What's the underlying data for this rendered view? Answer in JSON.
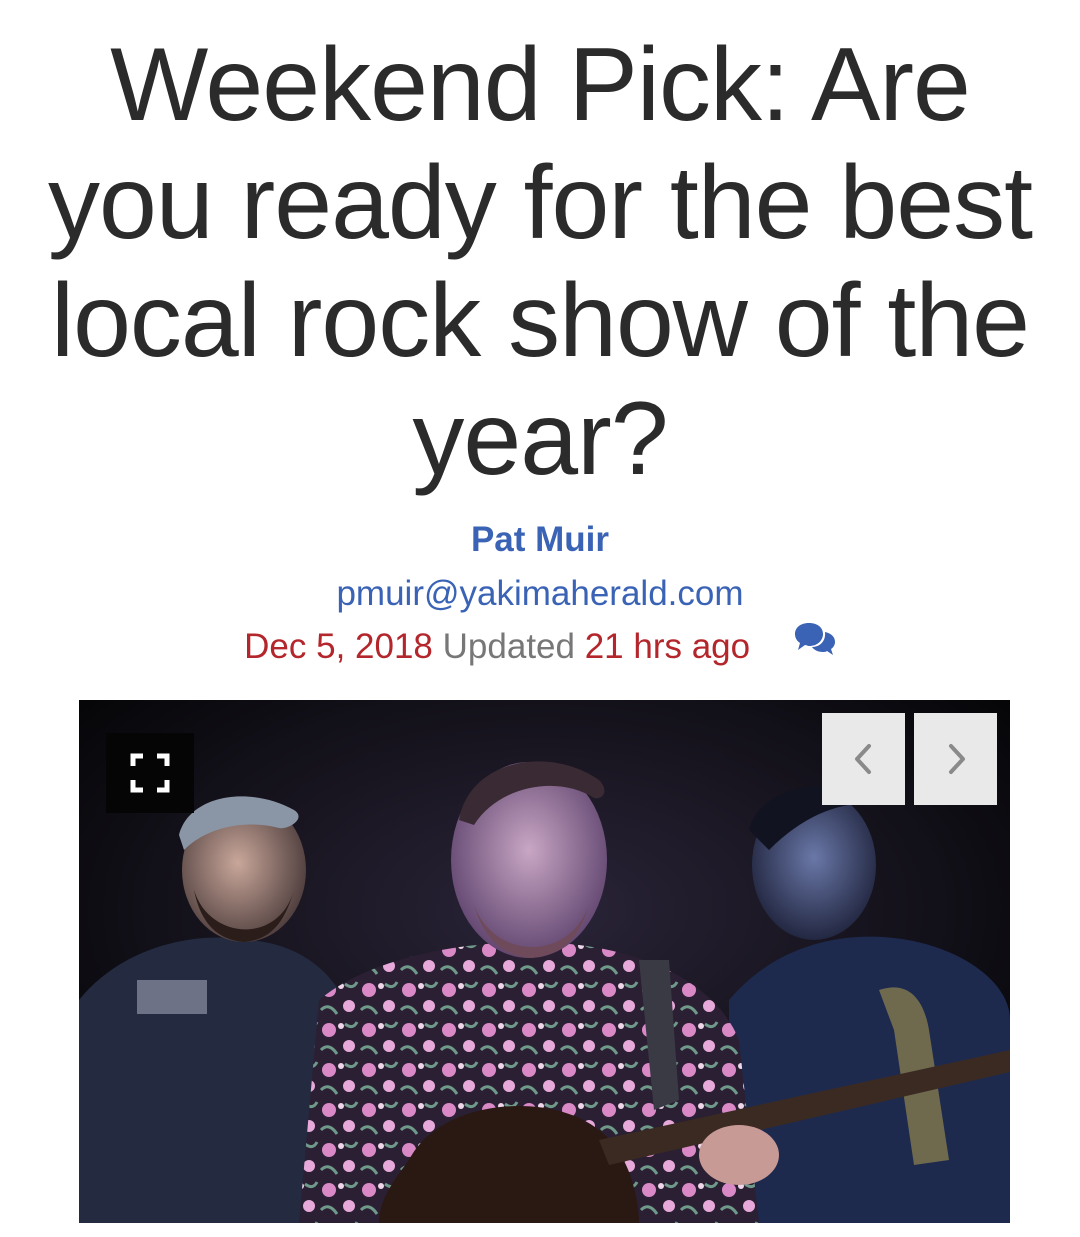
{
  "article": {
    "headline": "Weekend Pick: Are you ready for the best local rock show of the year?",
    "author": "Pat Muir",
    "email": "pmuir@yakimaherald.com",
    "date": "Dec 5, 2018",
    "updated_label": "Updated",
    "updated_time": "21 hrs ago"
  },
  "gallery": {
    "expand_icon": "expand-icon",
    "prev_icon": "chevron-left-icon",
    "next_icon": "chevron-right-icon"
  },
  "colors": {
    "headline": "#2b2b2b",
    "link": "#3a63b5",
    "date": "#b3262b",
    "muted": "#777777",
    "nav_button_bg": "#e9e9e9"
  }
}
